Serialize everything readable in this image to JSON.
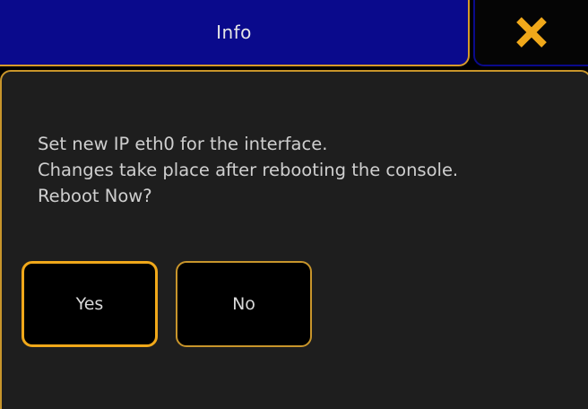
{
  "dialog": {
    "title": "Info",
    "close_icon": "close-x-icon",
    "message_lines": [
      "Set new IP eth0 for the interface.",
      "Changes take place after rebooting the console.",
      "Reboot Now?"
    ],
    "buttons": {
      "yes_label": "Yes",
      "no_label": "No"
    }
  },
  "colors": {
    "title_bar": "#0a0a8c",
    "accent_border": "#d69a2a",
    "close_icon": "#f0a81a",
    "panel_background": "#1e1e1e",
    "text": "#cfcfcf"
  }
}
